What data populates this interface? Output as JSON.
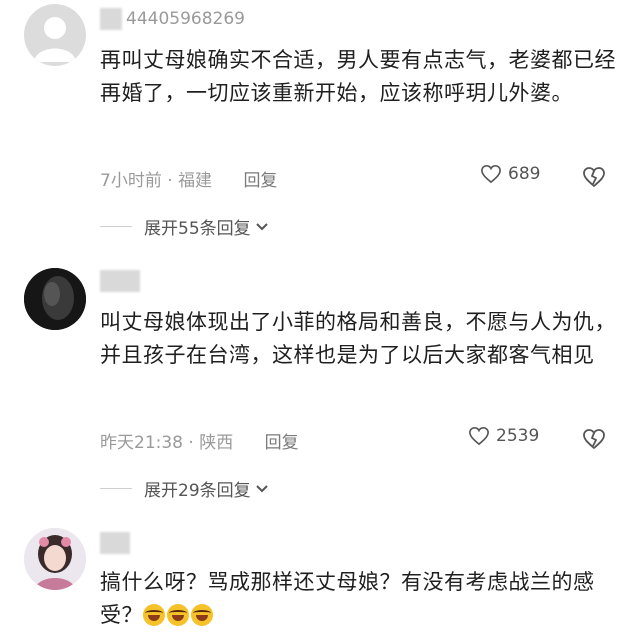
{
  "comments": [
    {
      "username": "44405968269",
      "text": "再叫丈母娘确实不合适，男人要有点志气，老婆都已经再婚了，一切应该重新开始，应该称呼玥儿外婆。",
      "time_location": "7小时前 · 福建",
      "reply_label": "回复",
      "likes": "689",
      "expand_label": "展开55条回复"
    },
    {
      "username": "",
      "text": "叫丈母娘体现出了小菲的格局和善良，不愿与人为仇，并且孩子在台湾，这样也是为了以后大家都客气相见",
      "time_location": "昨天21:38 · 陕西",
      "reply_label": "回复",
      "likes": "2539",
      "expand_label": "展开29条回复"
    },
    {
      "username": "",
      "text": "搞什么呀？骂成那样还丈母娘？有没有考虑战兰的感受？",
      "emoji_name": "rofl-emoji"
    }
  ],
  "icons": {
    "like": "heart-icon",
    "dislike": "broken-heart-icon",
    "expand": "chevron-down-icon"
  },
  "colors": {
    "meta_gray": "#9a9a9a",
    "text": "#1f1f1f"
  }
}
